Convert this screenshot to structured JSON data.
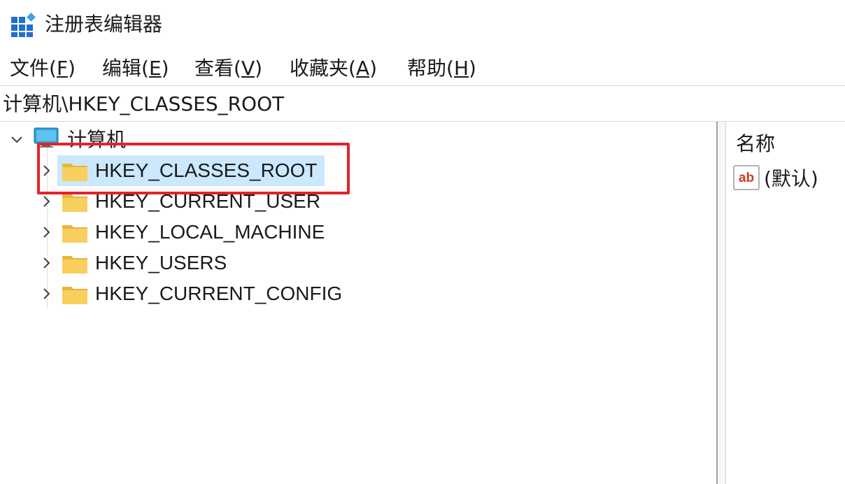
{
  "window": {
    "title": "注册表编辑器",
    "icon": "registry-editor-icon"
  },
  "menu": [
    {
      "label": "文件(",
      "accel": "F",
      "close": ")"
    },
    {
      "label": "编辑(",
      "accel": "E",
      "close": ")"
    },
    {
      "label": "查看(",
      "accel": "V",
      "close": ")"
    },
    {
      "label": "收藏夹(",
      "accel": "A",
      "close": ")"
    },
    {
      "label": "帮助(",
      "accel": "H",
      "close": ")"
    }
  ],
  "address": {
    "path": "计算机\\HKEY_CLASSES_ROOT"
  },
  "tree": {
    "root": {
      "label": "计算机",
      "icon": "computer-icon",
      "expanded": true
    },
    "children": [
      {
        "label": "HKEY_CLASSES_ROOT",
        "icon": "folder-icon",
        "selected": true
      },
      {
        "label": "HKEY_CURRENT_USER",
        "icon": "folder-icon",
        "selected": false
      },
      {
        "label": "HKEY_LOCAL_MACHINE",
        "icon": "folder-icon",
        "selected": false
      },
      {
        "label": "HKEY_USERS",
        "icon": "folder-icon",
        "selected": false
      },
      {
        "label": "HKEY_CURRENT_CONFIG",
        "icon": "folder-icon",
        "selected": false
      }
    ]
  },
  "values": {
    "column_name": "名称",
    "rows": [
      {
        "name": "(默认)",
        "icon": "string-value-icon"
      }
    ]
  },
  "colors": {
    "selection": "#cce8ff",
    "highlight_box": "#e0242a",
    "folder": "#f5c542"
  }
}
